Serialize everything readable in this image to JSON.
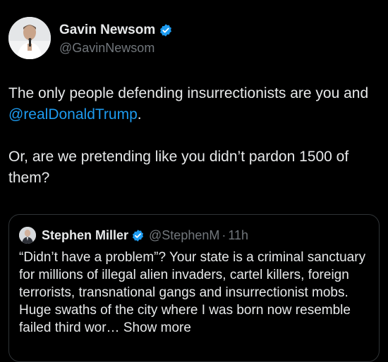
{
  "author": {
    "name": "Gavin Newsom",
    "handle": "@GavinNewsom",
    "verified": true,
    "avatar_icon": "profile-photo"
  },
  "body": {
    "line1_before": "The only people defending insurrectionists are you and ",
    "mention": "@realDonaldTrump",
    "line1_after": ".",
    "line2": "Or, are we pretending like you didn’t pardon 1500 of them?"
  },
  "quote": {
    "name": "Stephen Miller",
    "handle": "@StephenM",
    "separator": "·",
    "time": "11h",
    "verified": true,
    "text": "“Didn’t have a problem”? Your state is a criminal sanctuary for millions of illegal alien invaders, cartel killers, foreign terrorists, transnational gangs and insurrectionist mobs. Huge swaths of the city where I was born now resemble failed third wor… ",
    "show_more": "Show more"
  },
  "colors": {
    "background": "#000000",
    "text": "#e7e9ea",
    "secondary": "#71767b",
    "link": "#1d9bf0",
    "verified": "#1d9bf0",
    "border": "#2f3336"
  }
}
